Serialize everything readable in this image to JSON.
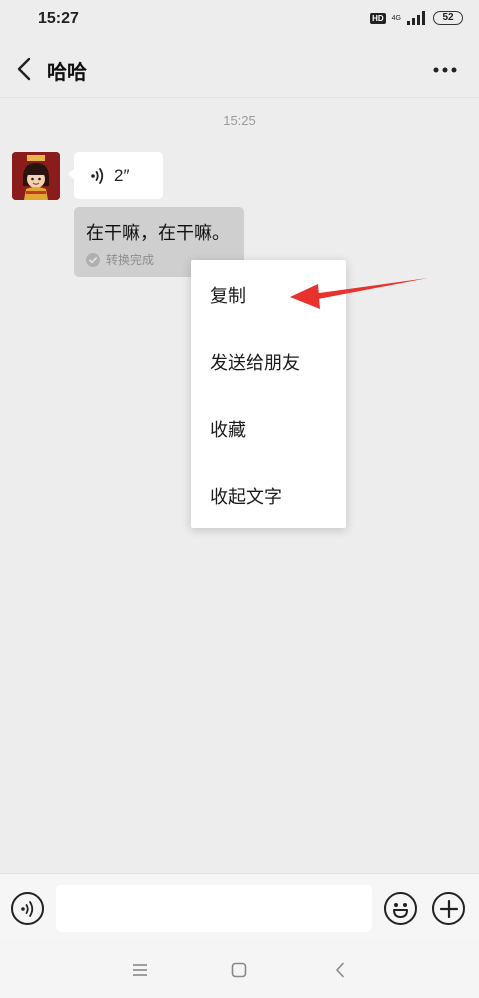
{
  "status_bar": {
    "time": "15:27",
    "hd_label": "HD",
    "network_label": "4G",
    "battery": "52"
  },
  "header": {
    "title": "哈哈",
    "back_icon": "chevron-left-icon",
    "more_icon": "more-dots-icon"
  },
  "chat": {
    "timestamp": "15:25",
    "voice_message": {
      "duration": "2″",
      "icon": "voice-wave-icon"
    },
    "text_message": "在干嘛，在干嘛。",
    "convert_status": "转换完成"
  },
  "context_menu": {
    "items": [
      {
        "label": "复制"
      },
      {
        "label": "发送给朋友"
      },
      {
        "label": "收藏"
      },
      {
        "label": "收起文字"
      }
    ]
  },
  "input_bar": {
    "placeholder": "",
    "voice_icon": "voice-icon",
    "emoji_icon": "emoji-icon",
    "plus_icon": "plus-icon"
  },
  "nav_bar": {
    "icons": [
      "menu-icon",
      "home-icon",
      "back-icon"
    ]
  },
  "colors": {
    "background": "#ededed",
    "bubble_white": "#ffffff",
    "bubble_gray": "#cfcfcf",
    "arrow_red": "#e8322d",
    "avatar_bg": "#8a1c1c"
  }
}
